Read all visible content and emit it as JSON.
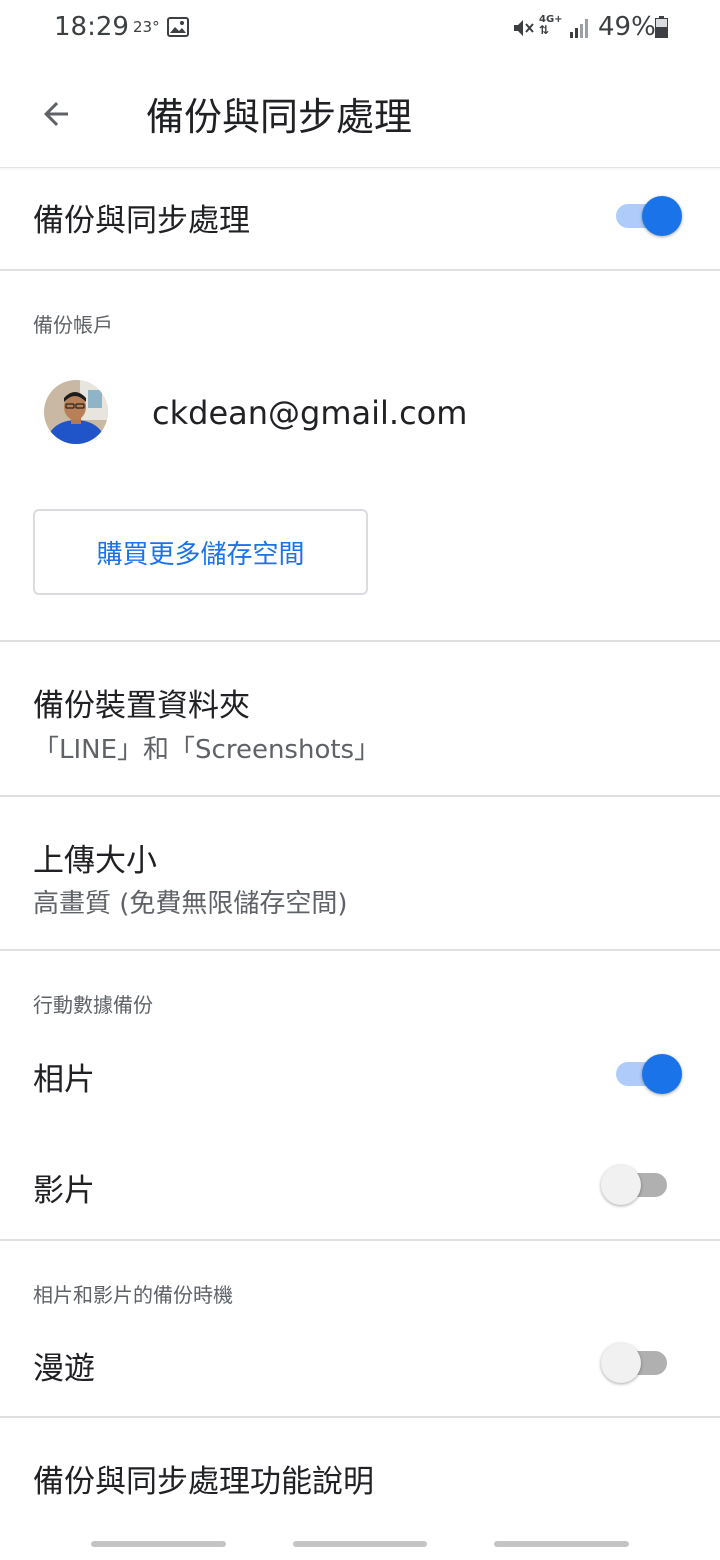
{
  "status_bar": {
    "time": "18:29",
    "temperature": "23°",
    "network": [
      "4G+",
      "⇅"
    ],
    "battery_percent": "49%",
    "icons": [
      "photo-icon",
      "mute-icon",
      "signal-icon",
      "battery-icon"
    ]
  },
  "app_bar": {
    "back_icon": "arrow-back-icon",
    "title": "備份與同步處理"
  },
  "master_toggle": {
    "label": "備份與同步處理",
    "on": true
  },
  "account_section": {
    "heading": "備份帳戶",
    "email": "ckdean@gmail.com",
    "buy_storage_label": "購買更多儲存空間"
  },
  "folders": {
    "title": "備份裝置資料夾",
    "subtitle": "「LINE」和「Screenshots」"
  },
  "upload_size": {
    "title": "上傳大小",
    "subtitle": "高畫質 (免費無限儲存空間)"
  },
  "mobile_data": {
    "heading": "行動數據備份",
    "photos_label": "相片",
    "photos_on": true,
    "videos_label": "影片",
    "videos_on": false
  },
  "when_to_backup": {
    "heading": "相片和影片的備份時機",
    "roaming_label": "漫遊",
    "roaming_on": false
  },
  "help": {
    "label": "備份與同步處理功能說明"
  },
  "colors": {
    "accent": "#1a73e8",
    "toggle_track_on": "#aecbfa",
    "toggle_track_off": "#b0b0b0",
    "text_primary": "#202124",
    "text_secondary": "#5f6368"
  }
}
